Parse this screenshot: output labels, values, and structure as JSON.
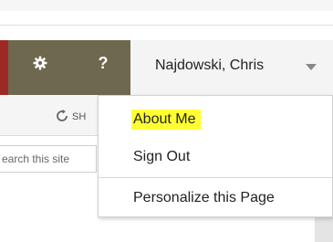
{
  "suite_bar": {
    "user_name": "Najdowski, Chris",
    "help_label": "?",
    "colors": {
      "accent_red": "#9b2a24",
      "bar_olive": "#6e684e",
      "user_area": "#f4f4f4"
    },
    "icons": {
      "settings": "gear-icon",
      "menu_caret": "chevron-down-icon"
    }
  },
  "ribbon": {
    "share_label": "SH",
    "share_icon": "share-icon"
  },
  "search": {
    "placeholder": "earch this site"
  },
  "user_menu": {
    "items": [
      {
        "label": "About Me",
        "highlight": "#ffff33"
      },
      {
        "label": "Sign Out"
      },
      {
        "label": "Personalize this Page"
      }
    ]
  }
}
